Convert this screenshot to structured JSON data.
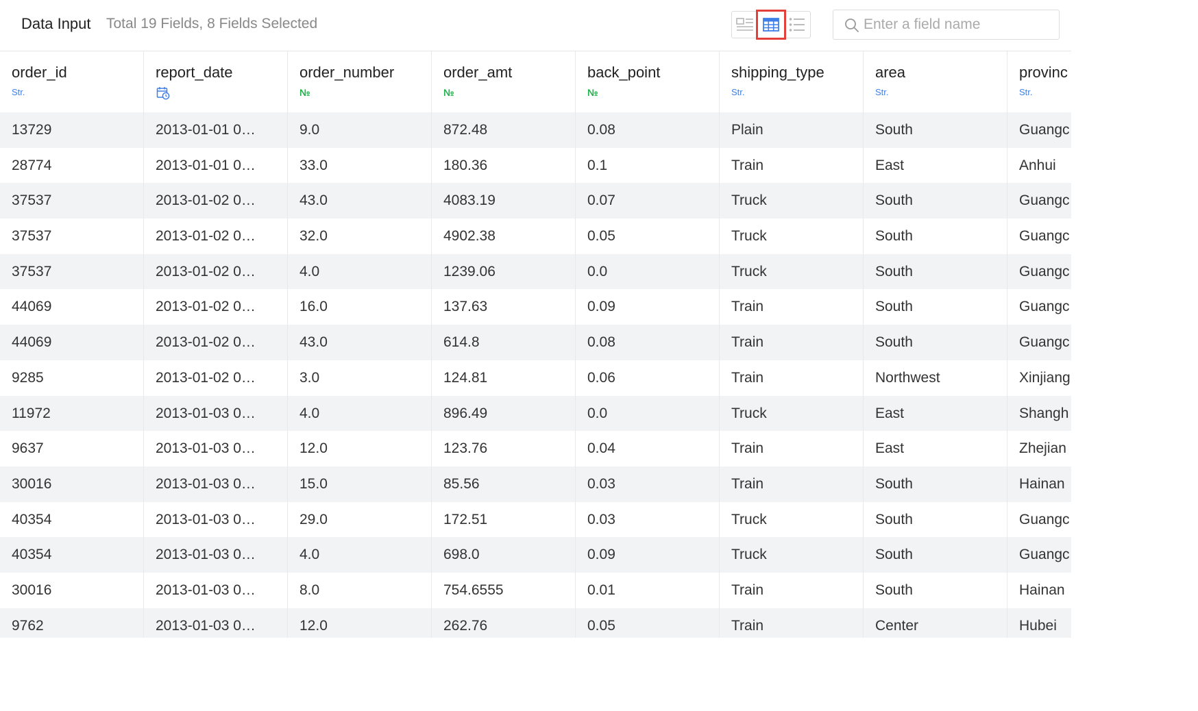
{
  "header": {
    "title": "Data Input",
    "subtitle": "Total 19 Fields, 8 Fields Selected",
    "view_icons": [
      "card-view-icon",
      "table-view-icon",
      "list-view-icon"
    ],
    "active_view": "table",
    "search_placeholder": "Enter a field name",
    "search_value": ""
  },
  "colors": {
    "accent": "#3f7fe8",
    "number_type": "#22b04d",
    "active_outline": "#e3403a",
    "stripe": "#f2f3f5"
  },
  "table": {
    "columns": [
      {
        "name": "order_id",
        "type": "Str."
      },
      {
        "name": "report_date",
        "type": "date-icon"
      },
      {
        "name": "order_number",
        "type": "№"
      },
      {
        "name": "order_amt",
        "type": "№"
      },
      {
        "name": "back_point",
        "type": "№"
      },
      {
        "name": "shipping_type",
        "type": "Str."
      },
      {
        "name": "area",
        "type": "Str."
      },
      {
        "name": "provinc",
        "type": "Str."
      }
    ],
    "rows": [
      [
        "13729",
        "2013-01-01 0…",
        "9.0",
        "872.48",
        "0.08",
        "Plain",
        "South",
        "Guangc"
      ],
      [
        "28774",
        "2013-01-01 0…",
        "33.0",
        "180.36",
        "0.1",
        "Train",
        "East",
        "Anhui"
      ],
      [
        "37537",
        "2013-01-02 0…",
        "43.0",
        "4083.19",
        "0.07",
        "Truck",
        "South",
        "Guangc"
      ],
      [
        "37537",
        "2013-01-02 0…",
        "32.0",
        "4902.38",
        "0.05",
        "Truck",
        "South",
        "Guangc"
      ],
      [
        "37537",
        "2013-01-02 0…",
        "4.0",
        "1239.06",
        "0.0",
        "Truck",
        "South",
        "Guangc"
      ],
      [
        "44069",
        "2013-01-02 0…",
        "16.0",
        "137.63",
        "0.09",
        "Train",
        "South",
        "Guangc"
      ],
      [
        "44069",
        "2013-01-02 0…",
        "43.0",
        "614.8",
        "0.08",
        "Train",
        "South",
        "Guangc"
      ],
      [
        "9285",
        "2013-01-02 0…",
        "3.0",
        "124.81",
        "0.06",
        "Train",
        "Northwest",
        "Xinjiang"
      ],
      [
        "11972",
        "2013-01-03 0…",
        "4.0",
        "896.49",
        "0.0",
        "Truck",
        "East",
        "Shangh"
      ],
      [
        "9637",
        "2013-01-03 0…",
        "12.0",
        "123.76",
        "0.04",
        "Train",
        "East",
        "Zhejian"
      ],
      [
        "30016",
        "2013-01-03 0…",
        "15.0",
        "85.56",
        "0.03",
        "Train",
        "South",
        "Hainan"
      ],
      [
        "40354",
        "2013-01-03 0…",
        "29.0",
        "172.51",
        "0.03",
        "Truck",
        "South",
        "Guangc"
      ],
      [
        "40354",
        "2013-01-03 0…",
        "4.0",
        "698.0",
        "0.09",
        "Truck",
        "South",
        "Guangc"
      ],
      [
        "30016",
        "2013-01-03 0…",
        "8.0",
        "754.6555",
        "0.01",
        "Train",
        "South",
        "Hainan"
      ],
      [
        "9762",
        "2013-01-03 0…",
        "12.0",
        "262.76",
        "0.05",
        "Train",
        "Center",
        "Hubei"
      ]
    ]
  }
}
